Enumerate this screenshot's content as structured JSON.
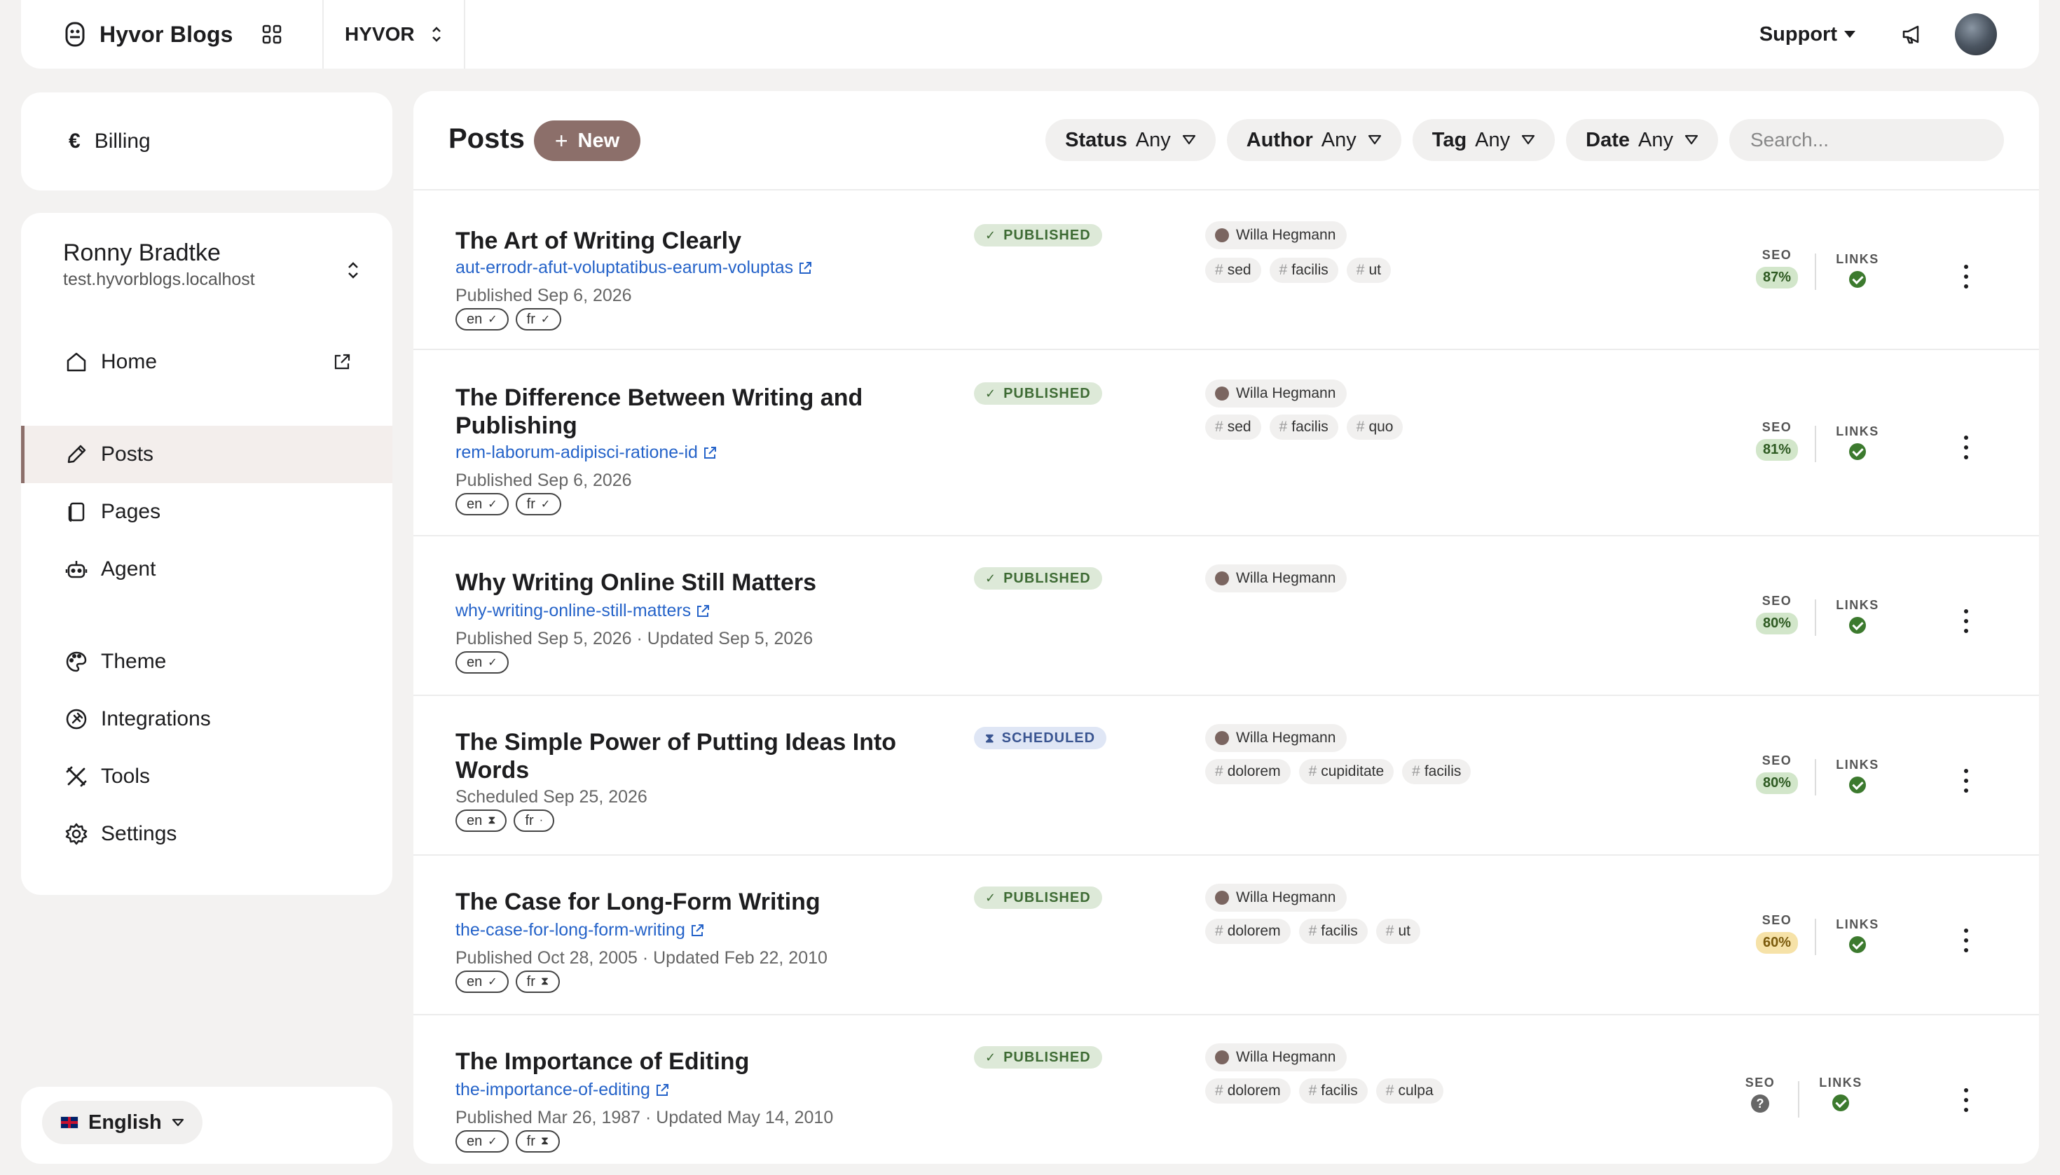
{
  "app": {
    "name": "Hyvor Blogs",
    "blog_name": "HYVOR"
  },
  "topbar": {
    "support_label": "Support"
  },
  "billing": {
    "label": "Billing",
    "icon": "euro-icon",
    "symbol": "€"
  },
  "user": {
    "name": "Ronny Bradtke",
    "host": "test.hyvorblogs.localhost"
  },
  "nav": {
    "home": "Home",
    "posts": "Posts",
    "pages": "Pages",
    "agent": "Agent",
    "theme": "Theme",
    "integrations": "Integrations",
    "tools": "Tools",
    "settings": "Settings",
    "active": "Posts"
  },
  "language": {
    "label": "English"
  },
  "posts_page": {
    "title": "Posts",
    "new_label": "New",
    "filters": {
      "status": {
        "label": "Status",
        "value": "Any"
      },
      "author": {
        "label": "Author",
        "value": "Any"
      },
      "tag": {
        "label": "Tag",
        "value": "Any"
      },
      "date": {
        "label": "Date",
        "value": "Any"
      }
    },
    "search_placeholder": "Search...",
    "seo_label": "SEO",
    "links_label": "LINKS"
  },
  "posts": [
    {
      "title": "The Art of Writing Clearly",
      "slug": "aut-errodr-afut-voluptatibus-earum-voluptas",
      "date": "Published Sep 6, 2026",
      "status": "PUBLISHED",
      "author": "Willa Hegmann",
      "tags": [
        "sed",
        "facilis",
        "ut"
      ],
      "langs": [
        {
          "code": "en",
          "state": "✓"
        },
        {
          "code": "fr",
          "state": "✓"
        }
      ],
      "seo": "87%",
      "links": "ok"
    },
    {
      "title": "The Difference Between Writing and Publishing",
      "slug": "rem-laborum-adipisci-ratione-id",
      "date": "Published Sep 6, 2026",
      "status": "PUBLISHED",
      "author": "Willa Hegmann",
      "tags": [
        "sed",
        "facilis",
        "quo"
      ],
      "langs": [
        {
          "code": "en",
          "state": "✓"
        },
        {
          "code": "fr",
          "state": "✓"
        }
      ],
      "seo": "81%",
      "links": "ok"
    },
    {
      "title": "Why Writing Online Still Matters",
      "slug": "why-writing-online-still-matters",
      "date": "Published Sep 5, 2026 · Updated Sep 5, 2026",
      "status": "PUBLISHED",
      "author": "Willa Hegmann",
      "tags": [],
      "langs": [
        {
          "code": "en",
          "state": "✓"
        }
      ],
      "seo": "80%",
      "links": "ok"
    },
    {
      "title": "The Simple Power of Putting Ideas Into Words",
      "slug": "",
      "date": "Scheduled Sep 25, 2026",
      "status": "SCHEDULED",
      "author": "Willa Hegmann",
      "tags": [
        "dolorem",
        "cupiditate",
        "facilis"
      ],
      "langs": [
        {
          "code": "en",
          "state": "⧗"
        },
        {
          "code": "fr",
          "state": "·"
        }
      ],
      "seo": "80%",
      "links": "ok"
    },
    {
      "title": "The Case for Long-Form Writing",
      "slug": "the-case-for-long-form-writing",
      "date": "Published Oct 28, 2005 · Updated Feb 22, 2010",
      "status": "PUBLISHED",
      "author": "Willa Hegmann",
      "tags": [
        "dolorem",
        "facilis",
        "ut"
      ],
      "langs": [
        {
          "code": "en",
          "state": "✓"
        },
        {
          "code": "fr",
          "state": "⧗"
        }
      ],
      "seo": "60%",
      "links": "ok"
    },
    {
      "title": "The Importance of Editing",
      "slug": "the-importance-of-editing",
      "date": "Published Mar 26, 1987 · Updated May 14, 2010",
      "status": "PUBLISHED",
      "author": "Willa Hegmann",
      "tags": [
        "dolorem",
        "facilis",
        "culpa"
      ],
      "langs": [
        {
          "code": "en",
          "state": "✓"
        },
        {
          "code": "fr",
          "state": "⧗"
        }
      ],
      "seo": "?",
      "links": "ok"
    }
  ],
  "colors": {
    "accent": "#8c6f6a",
    "link": "#2563c9",
    "published_bg": "#dde9d8",
    "scheduled_bg": "#dfe6f5",
    "seo_good": "#d2e6ca",
    "seo_mid": "#f6e2a8"
  }
}
